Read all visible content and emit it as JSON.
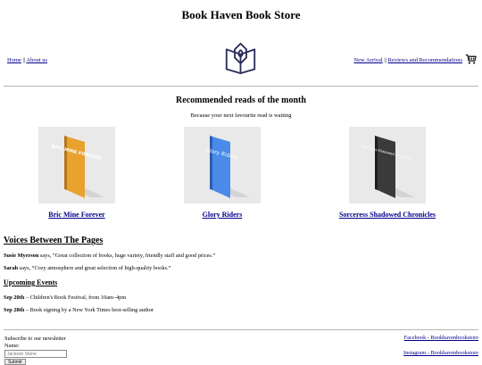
{
  "header": {
    "site_title": "Book Haven Book Store",
    "nav_left": {
      "home": "Home",
      "separator": " || ",
      "about": "About us"
    },
    "nav_right": {
      "new_arrival": "New Arrival",
      "separator": " || ",
      "reviews": "Reviews and Recommendations"
    },
    "logo_icon": "open-book-logo-icon",
    "cart_icon": "shopping-cart-icon"
  },
  "recommended": {
    "title": "Recommended reads of the month",
    "subtitle": "Because your next favourite read is waiting",
    "books": [
      {
        "title": "Bric Mine Forever",
        "cover_text": "BRIC MINE FOREVER",
        "cover_color": "#e8a22d"
      },
      {
        "title": "Glory Riders",
        "cover_text": "Glory Riders",
        "cover_color": "#4b8ae8"
      },
      {
        "title": "Sorceress Shadowed Chronicles",
        "cover_text": "Sorceress Shadowed Chronicles",
        "cover_color": "#3a3a3a"
      }
    ]
  },
  "voices": {
    "title": "Voices Between The Pages",
    "reviews": [
      {
        "name": "Susie Myerson",
        "says": " says, “Great collection of books, huge variety, friendly staff and good prices.”"
      },
      {
        "name": "Sarah",
        "says": " says, “Cozy atmosphere and great selection of high-quality books.”"
      }
    ]
  },
  "events": {
    "title": "Upcoming Events",
    "items": [
      {
        "date": "Sep 20th",
        "desc": " – Children's Book Festival, from 10am–4pm"
      },
      {
        "date": "Sep 28th",
        "desc": " – Book signing by a New York Times best-selling author"
      }
    ]
  },
  "footer": {
    "newsletter_label": "Subscribe to our newsletter",
    "name_label": "Name:",
    "name_placeholder": "Jackson Stone",
    "submit_label": "Submit",
    "facebook": "Facebook - Bookhavenbookstore",
    "instagram": "Instagram - Bookhavenbookstore"
  },
  "colors": {
    "link": "#00008b",
    "card_bg": "#e9e9e9",
    "logo_stroke": "#2b2d5c"
  }
}
